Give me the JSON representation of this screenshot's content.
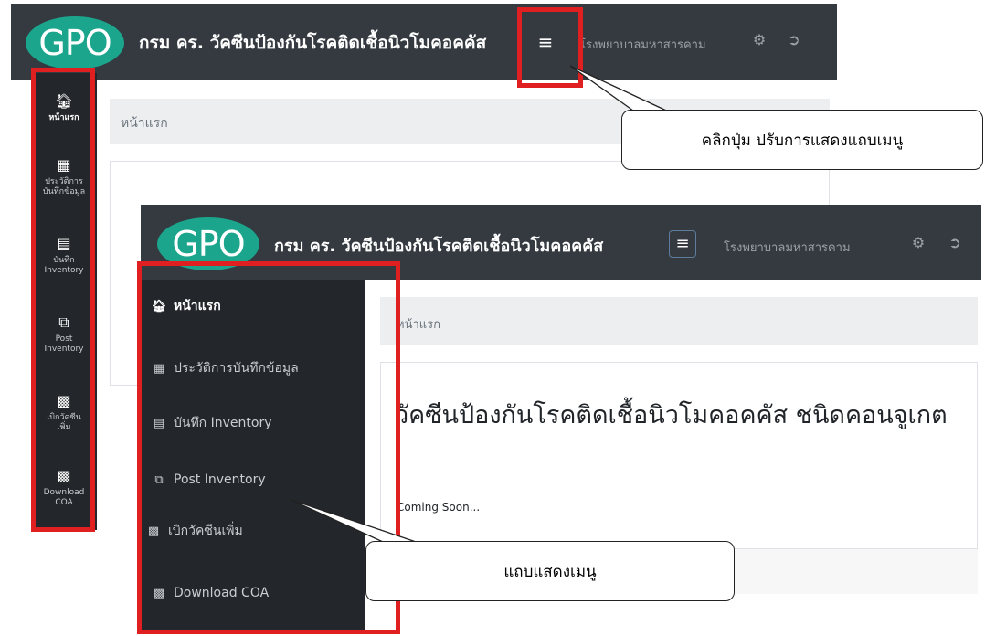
{
  "back_screen": {
    "logo": "GPO",
    "title": "กรม คร. วัคซีนป้องกันโรคติดเชื้อนิวโมคอคคัส",
    "hospital": "โรงพยาบาลมหาสารคาม",
    "breadcrumb": "หน้าแรก",
    "menu_collapsed": true,
    "rail": [
      {
        "icon": "home-icon",
        "label": "หน้าแรก",
        "active": true
      },
      {
        "icon": "calendar-icon",
        "label": "ประวัติการ บันทึกข้อมูล"
      },
      {
        "icon": "file-icon",
        "label": "บันทึก Inventory"
      },
      {
        "icon": "files-icon",
        "label": "Post Inventory"
      },
      {
        "icon": "file-pdf-icon",
        "label": "เบิกวัคซีน เพิ่ม"
      },
      {
        "icon": "download-icon",
        "label": "Download COA"
      }
    ]
  },
  "front_screen": {
    "logo": "GPO",
    "title": "กรม คร. วัคซีนป้องกันโรคติดเชื้อนิวโมคอคคัส",
    "hospital": "โรงพยาบาลมหาสารคาม",
    "breadcrumb": "หน้าแรก",
    "heading": "วัคซีนป้องกันโรคติดเชื้อนิวโมคอคคัส ชนิดคอนจูเกต",
    "coming_soon": "Coming Soon...",
    "menu_collapsed": false,
    "sidebar": [
      {
        "icon": "home-icon",
        "label": "หน้าแรก",
        "active": true
      },
      {
        "icon": "calendar-icon",
        "label": "ประวัติการบันทึกข้อมูล"
      },
      {
        "icon": "file-icon",
        "label": "บันทึก Inventory"
      },
      {
        "icon": "files-icon",
        "label": "Post Inventory"
      },
      {
        "icon": "file-pdf-icon",
        "label": "เบิกวัคซีนเพิ่ม"
      },
      {
        "icon": "download-icon",
        "label": "Download COA"
      }
    ]
  },
  "annotations": {
    "toggle_callout": "คลิกปุ่ม ปรับการแสดงแถบเมนู",
    "menu_callout": "แถบแสดงเมนู"
  },
  "colors": {
    "topbar": "#343a40",
    "sidebar": "#23272b",
    "logo": "#1ba58c",
    "highlight": "#e02020"
  }
}
